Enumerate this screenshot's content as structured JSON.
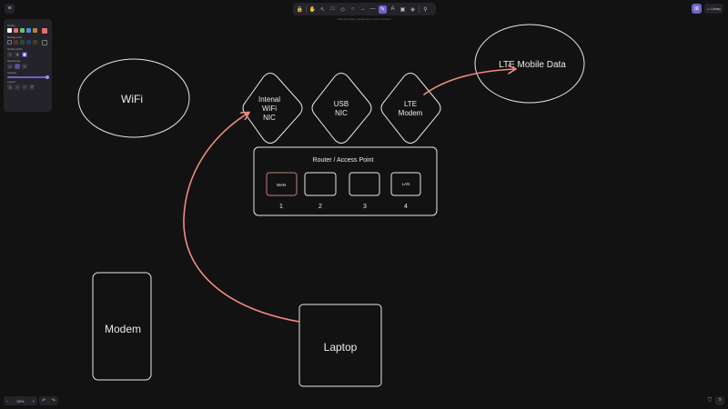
{
  "menu": {
    "icon": "hamburger-icon",
    "glyph": "≡"
  },
  "toolbar": {
    "tools": [
      {
        "name": "lock-icon",
        "glyph": "🔒"
      },
      {
        "name": "hand-icon",
        "glyph": "✋"
      },
      {
        "name": "selection-icon",
        "glyph": "↖"
      },
      {
        "name": "rectangle-icon",
        "glyph": "□"
      },
      {
        "name": "diamond-icon",
        "glyph": "◇"
      },
      {
        "name": "ellipse-icon",
        "glyph": "○"
      },
      {
        "name": "arrow-icon",
        "glyph": "→"
      },
      {
        "name": "line-icon",
        "glyph": "—"
      },
      {
        "name": "pencil-icon",
        "glyph": "✎",
        "active": true
      },
      {
        "name": "text-icon",
        "glyph": "A"
      },
      {
        "name": "image-icon",
        "glyph": "▣"
      },
      {
        "name": "eraser-icon",
        "glyph": "◈"
      },
      {
        "name": "more-tools-icon",
        "glyph": "⚲"
      }
    ]
  },
  "hint": "Click and drag, release when you're finished",
  "library": {
    "icon_glyph": "⊞",
    "label": "Library"
  },
  "properties": {
    "stroke_title": "Stroke",
    "stroke_colors": [
      "#ffffff",
      "#e26f6f",
      "#6bbf68",
      "#4a8fe0",
      "#c27c36"
    ],
    "current_stroke": "#e26f6f",
    "background_title": "Background",
    "stroke_width_title": "Stroke width",
    "sloppiness_title": "Sloppiness",
    "edges_title": "Edges",
    "opacity_title": "Opacity",
    "opacity": 100,
    "layers_title": "Layers",
    "layer_glyphs": [
      "⤓",
      "↓",
      "↑",
      "⤒"
    ]
  },
  "canvas": {
    "wifi_label": "WiFi",
    "lte_data_label": "LTE Mobile Data",
    "internal_nic_lines": [
      "Intenal",
      "WiFi",
      "NIC"
    ],
    "usb_nic_lines": [
      "USB",
      "NIC"
    ],
    "lte_modem_lines": [
      "LTE",
      "Modem"
    ],
    "router_title": "Router / Access Point",
    "ports": [
      {
        "label": "WAN",
        "number": "1"
      },
      {
        "label": "",
        "number": "2"
      },
      {
        "label": "",
        "number": "3"
      },
      {
        "label": "LAN",
        "number": "4"
      }
    ],
    "modem_label": "Modem",
    "laptop_label": "Laptop",
    "arrow_color": "#f28b82",
    "stroke_color": "#e8e8e8"
  },
  "footer": {
    "zoom_out_glyph": "−",
    "zoom": "52%",
    "zoom_in_glyph": "+",
    "undo_glyph": "↶",
    "redo_glyph": "↷",
    "shield_glyph": "⛉",
    "help_glyph": "?"
  }
}
